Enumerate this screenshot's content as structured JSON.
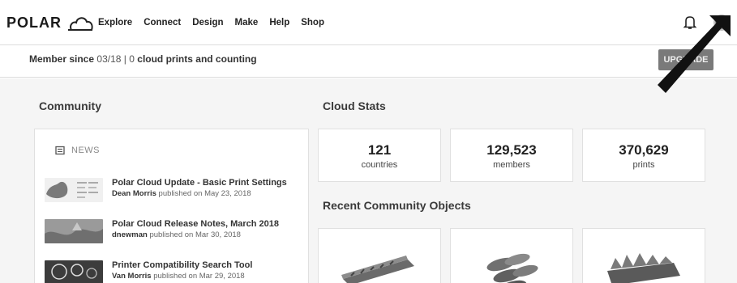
{
  "brand": {
    "logo_text": "POLAR"
  },
  "nav": {
    "items": [
      "Explore",
      "Connect",
      "Design",
      "Make",
      "Help",
      "Shop"
    ]
  },
  "member": {
    "prefix": "Member since",
    "since": "03/18",
    "separator": "|",
    "prints_count": "0",
    "suffix": "cloud prints and counting"
  },
  "upgrade_button": {
    "label": "UPGRADE"
  },
  "community": {
    "title": "Community",
    "news_label": "NEWS",
    "items": [
      {
        "title": "Polar Cloud Update - Basic Print Settings",
        "author": "Dean Morris",
        "published": "published on May 23, 2018"
      },
      {
        "title": "Polar Cloud Release Notes, March 2018",
        "author": "dnewman",
        "published": "published on Mar 30, 2018"
      },
      {
        "title": "Printer Compatibility Search Tool",
        "author": "Van Morris",
        "published": "published on Mar 29, 2018"
      }
    ]
  },
  "cloud_stats": {
    "title": "Cloud Stats",
    "stats": [
      {
        "value": "121",
        "label": "countries"
      },
      {
        "value": "129,523",
        "label": "members"
      },
      {
        "value": "370,629",
        "label": "prints"
      }
    ]
  },
  "recent_objects": {
    "title": "Recent Community Objects"
  },
  "icons": [
    "cloud-logo-icon",
    "bell-icon",
    "user-avatar",
    "newspaper-icon",
    "pointer-arrow"
  ]
}
